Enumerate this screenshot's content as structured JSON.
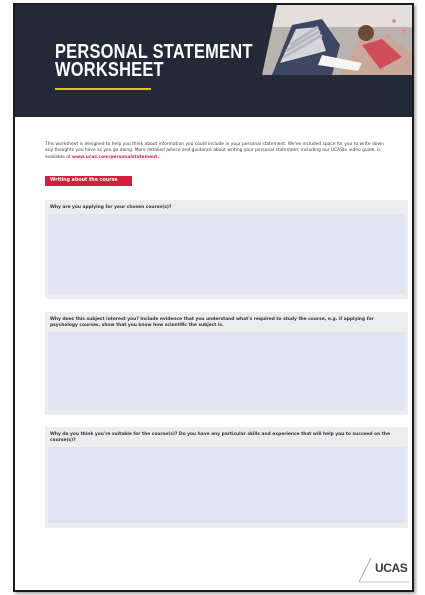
{
  "header": {
    "title_line1": "PERSONAL STATEMENT",
    "title_line2": "WORKSHEET"
  },
  "intro": {
    "text": "This worksheet is designed to help you think about information you could include in your personal statement. We've included space for you to write down any thoughts you have as you go along. More detailed advice and guidance about writing your personal statement, including our UCAStv video guide, is available at ",
    "link": "www.ucas.com/personalstatement."
  },
  "section": {
    "label": "Writing about the course"
  },
  "questions": [
    {
      "text": "Why are you applying for your chosen course(s)?"
    },
    {
      "text": "Why does this subject interest you? Include evidence that you understand what's required to study the course, e.g. if applying for psychology courses, show that you know how scientific the subject is."
    },
    {
      "text": "Why do you think you're suitable for the course(s)? Do you have any particular skills and experience that will help you to succeed on the course(s)?"
    }
  ],
  "logo": {
    "text": "UCAS"
  },
  "colors": {
    "header_bg": "#232937",
    "accent_red": "#d41f3c",
    "accent_yellow": "#e8b931",
    "answer_fill": "#e0e3f1"
  }
}
